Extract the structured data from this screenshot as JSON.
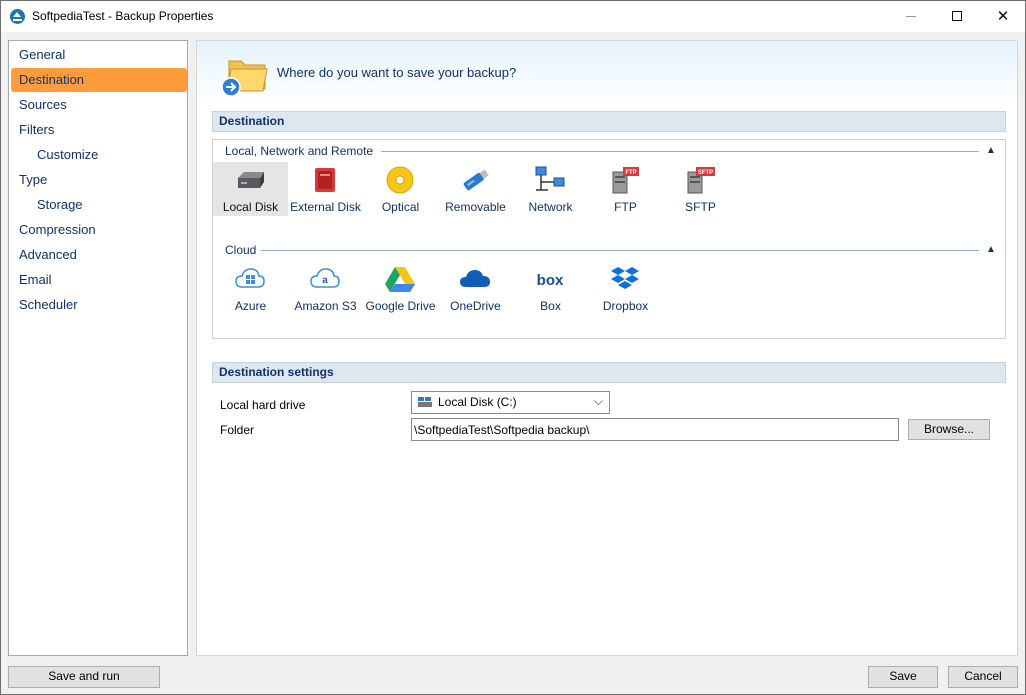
{
  "window": {
    "title": "SoftpediaTest - Backup Properties"
  },
  "sidebar": {
    "items": [
      {
        "label": "General"
      },
      {
        "label": "Destination"
      },
      {
        "label": "Sources"
      },
      {
        "label": "Filters"
      },
      {
        "label": "Customize"
      },
      {
        "label": "Type"
      },
      {
        "label": "Storage"
      },
      {
        "label": "Compression"
      },
      {
        "label": "Advanced"
      },
      {
        "label": "Email"
      },
      {
        "label": "Scheduler"
      }
    ]
  },
  "header": {
    "question": "Where do you want to save your backup?"
  },
  "destination": {
    "title": "Destination",
    "local_group": "Local, Network and Remote",
    "cloud_group": "Cloud",
    "local_items": [
      "Local Disk",
      "External Disk",
      "Optical",
      "Removable",
      "Network",
      "FTP",
      "SFTP"
    ],
    "cloud_items": [
      "Azure",
      "Amazon S3",
      "Google Drive",
      "OneDrive",
      "Box",
      "Dropbox"
    ],
    "selected": "Local Disk"
  },
  "settings": {
    "title": "Destination settings",
    "drive_label": "Local hard drive",
    "drive_value": "Local Disk (C:)",
    "folder_label": "Folder",
    "folder_value": "\\SoftpediaTest\\Softpedia backup\\",
    "browse_label": "Browse..."
  },
  "footer": {
    "save_and_run": "Save and run",
    "save": "Save",
    "cancel": "Cancel"
  },
  "icons": {
    "ftp_badge": "FTP",
    "sftp_badge": "SFTP",
    "box_text": "box"
  },
  "colors": {
    "selected_nav": "#fc9c3d",
    "accent_text": "#12316b",
    "section_bar": "#dde7f0"
  }
}
